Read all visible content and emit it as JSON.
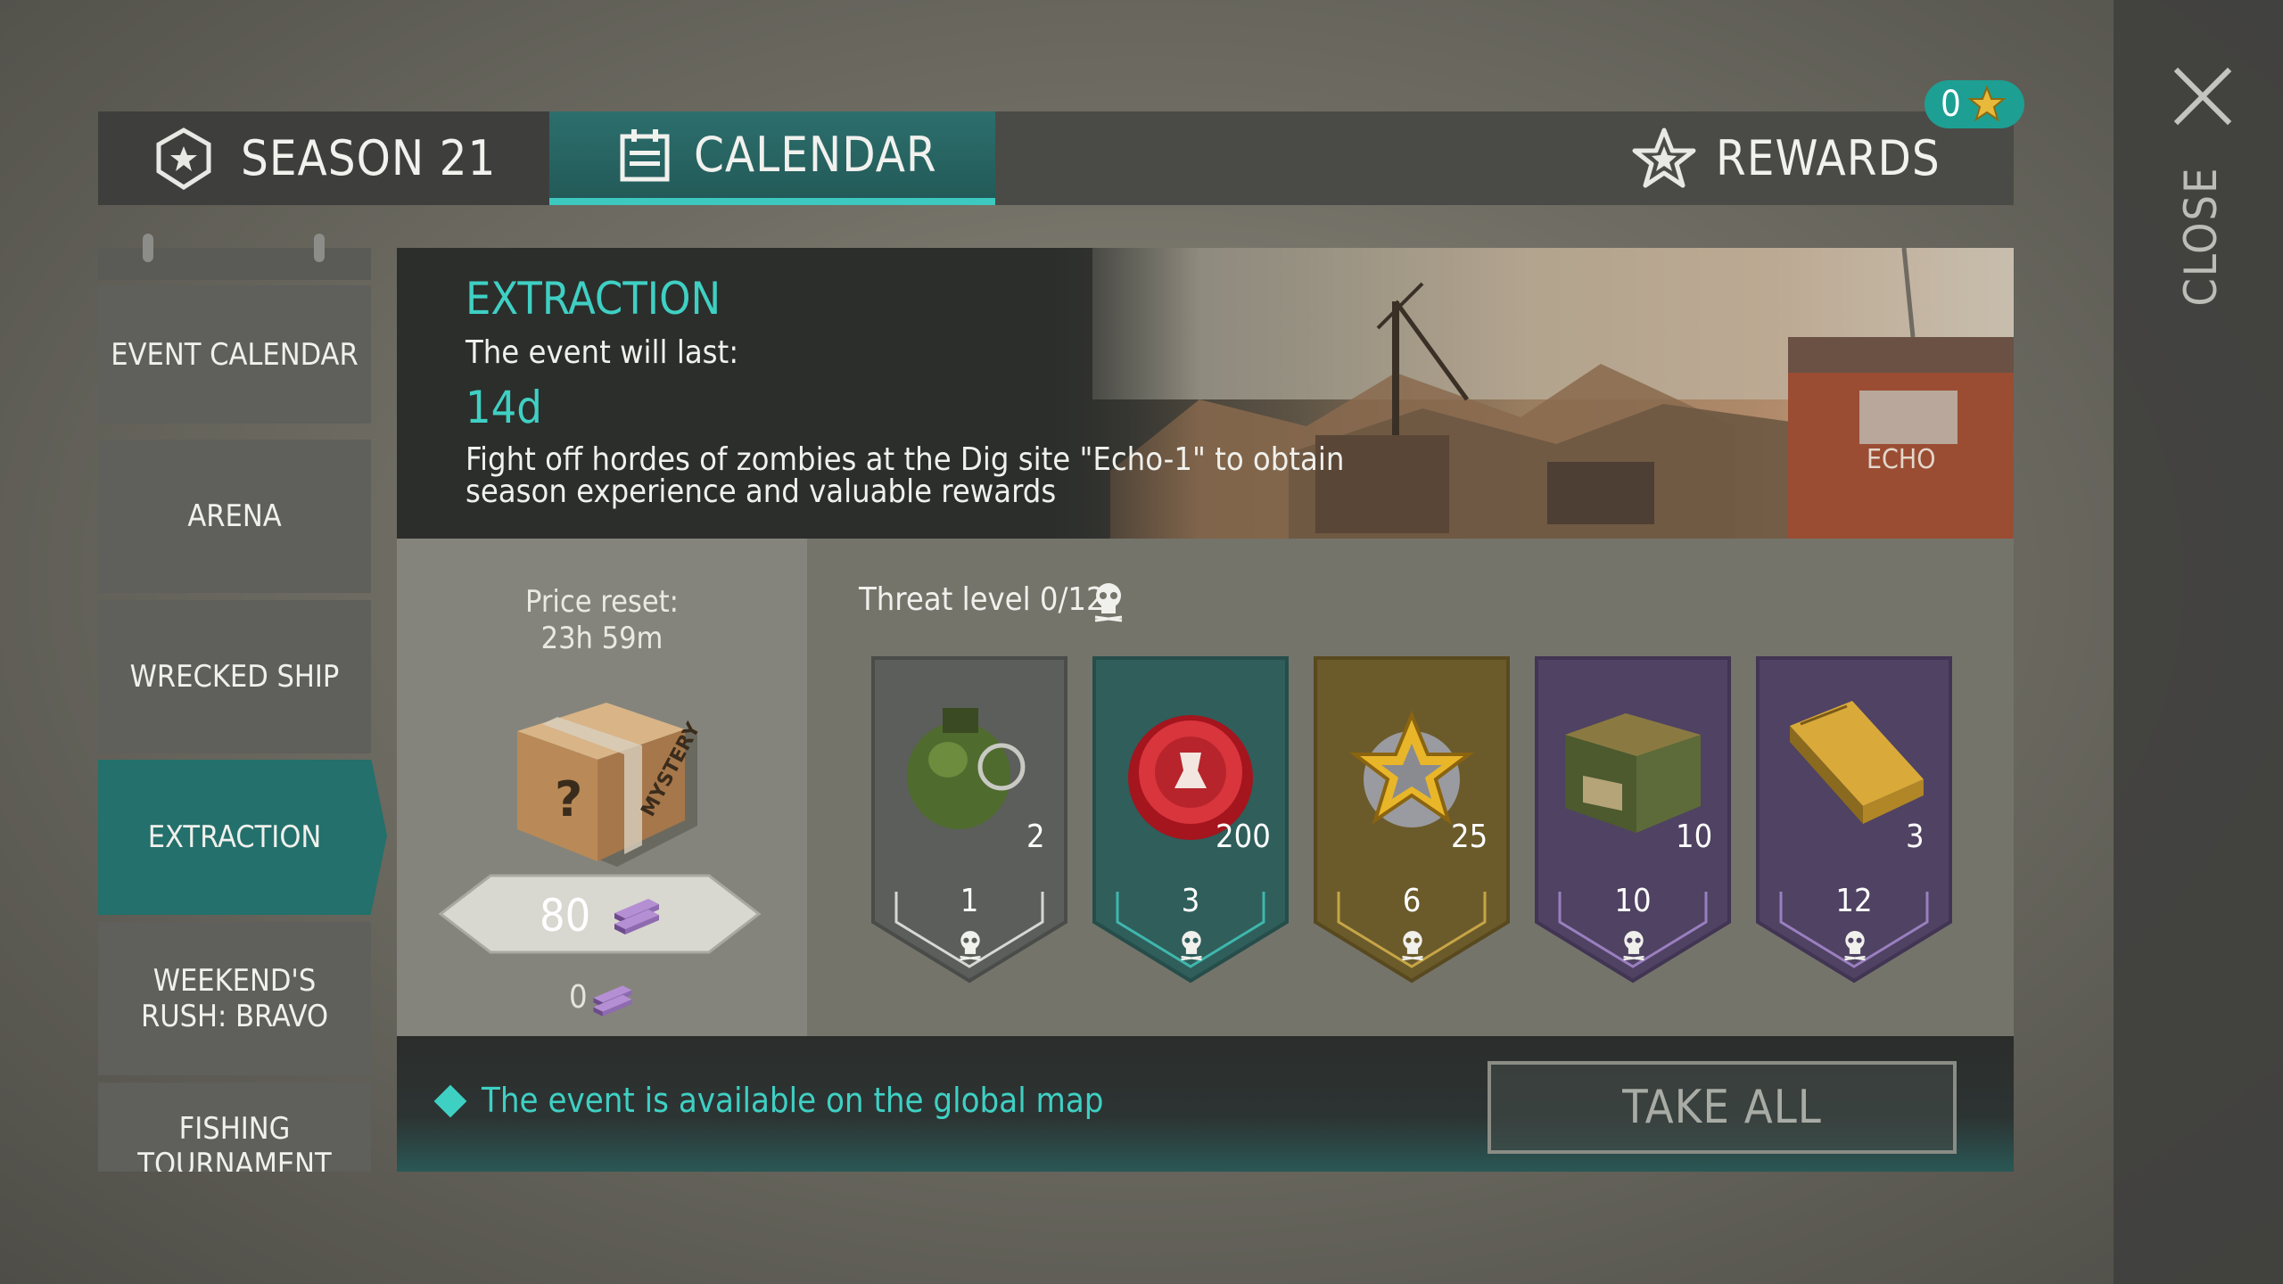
{
  "window": {
    "close_label": "CLOSE"
  },
  "header": {
    "tabs": [
      {
        "label": "SEASON 21",
        "icon": "season-shield-icon",
        "active": false
      },
      {
        "label": "CALENDAR",
        "icon": "calendar-icon",
        "active": true
      }
    ],
    "rewards": {
      "label": "REWARDS",
      "icon": "star-icon",
      "badge_count": "0"
    }
  },
  "sidebar": {
    "items": [
      {
        "label": "EVENT CALENDAR",
        "active": false
      },
      {
        "label": "ARENA",
        "active": false
      },
      {
        "label": "WRECKED SHIP",
        "active": false
      },
      {
        "label": "EXTRACTION",
        "active": true
      },
      {
        "label": "WEEKEND'S RUSH: BRAVO",
        "active": false
      },
      {
        "label": "FISHING TOURNAMENT",
        "active": false
      }
    ]
  },
  "event": {
    "title": "EXTRACTION",
    "lasts_label": "The event will last:",
    "duration": "14d",
    "description": "Fight off hordes of zombies at the Dig site \"Echo-1\" to obtain season experience and valuable rewards",
    "banner_sign": "ECHO"
  },
  "shop": {
    "price_reset_label": "Price reset:",
    "price_reset_time": "23h 59m",
    "box_label": "MYSTERY",
    "price": "80",
    "owned": "0",
    "currency_icon": "purple-bar-icon"
  },
  "threat": {
    "label": "Threat level 0/12",
    "rewards": [
      {
        "item": "grenade",
        "quantity": "2",
        "level": "1",
        "color": "#5b5e5a"
      },
      {
        "item": "bottle-cap",
        "quantity": "200",
        "level": "3",
        "color": "#2f5e5b"
      },
      {
        "item": "season-star",
        "quantity": "25",
        "level": "6",
        "color": "#6b5b2b"
      },
      {
        "item": "military-crate",
        "quantity": "10",
        "level": "10",
        "color": "#4f4262"
      },
      {
        "item": "blueprint-folder",
        "quantity": "3",
        "level": "12",
        "color": "#4f4262"
      }
    ]
  },
  "footer": {
    "note": "The event is available on the global map",
    "take_all_label": "TAKE ALL"
  }
}
